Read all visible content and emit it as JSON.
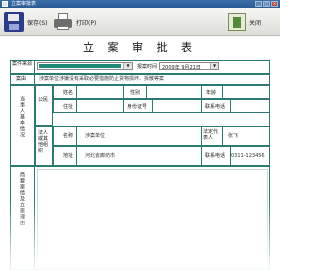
{
  "window": {
    "title": "立案审批表"
  },
  "toolbar": {
    "save_label": "保存(S)",
    "print_label": "打印(P)",
    "exit_label": "关闭"
  },
  "form": {
    "title": "立 案 审 批 表",
    "case_source_label": "案件来源",
    "case_source_value": "",
    "report_time_label": "报案时间",
    "report_date": "2009年 9月21日",
    "case_label": "案由",
    "case_value": "涉案单位涉嫌没有采取必要措施防止货物损坏、拆散等案",
    "party_section_label": "当事人基本情况",
    "citizen_label": "公民",
    "name_label": "姓名",
    "gender_label": "性别",
    "age_label": "年龄",
    "address_label": "住址",
    "id_label": "身份证号",
    "phone_label": "联系电话",
    "legal_label": "法人或其他组织",
    "org_name_label": "名称",
    "org_name_value": "涉案单位",
    "legal_rep_label": "法定代表人",
    "legal_rep_value": "张飞",
    "org_addr_label": "地址",
    "org_addr_value": "河北省廊坊市",
    "org_phone_label": "联系电话",
    "org_phone_value": "0311-123456",
    "brief_label": "简要案情及立案理由"
  }
}
